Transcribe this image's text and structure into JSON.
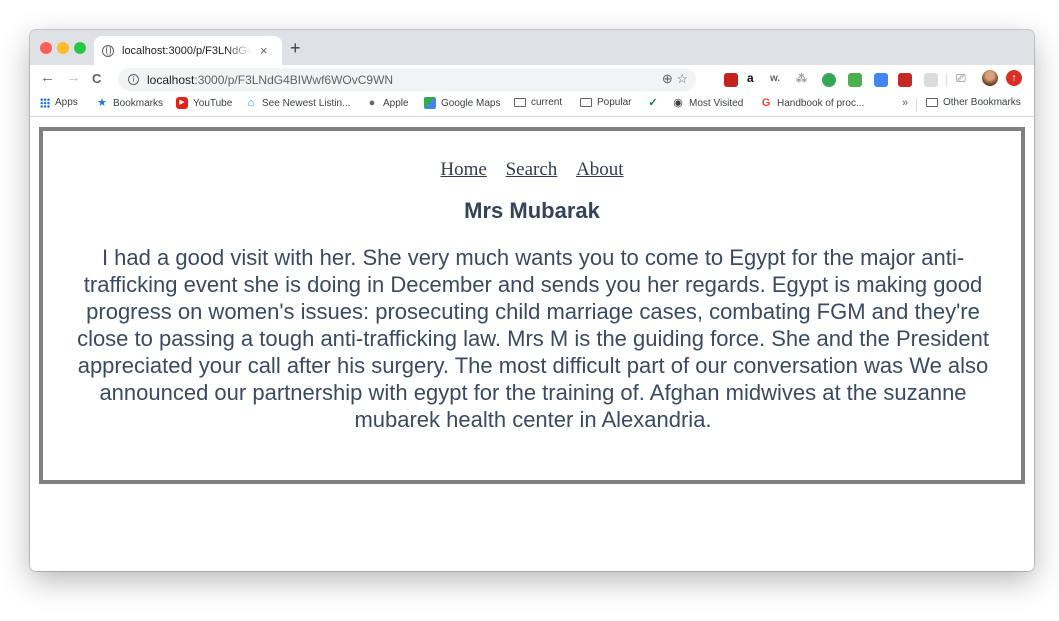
{
  "browser": {
    "tab": {
      "title": "localhost:3000/p/F3LNdG4BIWwf6WOvC9WN",
      "close": "×"
    },
    "new_tab": "+",
    "nav": {
      "back": "←",
      "forward": "→",
      "reload": "C"
    },
    "address": {
      "host": "localhost",
      "rest": ":3000/p/F3LNdG4BIWwf6WOvC9WN"
    },
    "omni_icons": "⊕ ☆",
    "bookmarks": [
      {
        "label": "Apps",
        "icon": "apps-grid-icon"
      },
      {
        "label": "Bookmarks",
        "icon": "star-icon"
      },
      {
        "label": "YouTube",
        "icon": "youtube-icon"
      },
      {
        "label": "See Newest Listin...",
        "icon": "home-icon"
      },
      {
        "label": "Apple",
        "icon": "apple-icon"
      },
      {
        "label": "Google Maps",
        "icon": "maps-icon"
      },
      {
        "label": "current",
        "icon": "folder-icon"
      },
      {
        "label": "Popular",
        "icon": "folder-icon"
      },
      {
        "label": "",
        "icon": "checkmark-icon"
      },
      {
        "label": "Most Visited",
        "icon": "globe-icon"
      },
      {
        "label": "Handbook of proc...",
        "icon": "google-icon"
      }
    ],
    "more_bookmarks": "»",
    "other_bookmarks": "Other Bookmarks",
    "colors": {
      "tabstrip": "#dee1e6",
      "omnibox": "#f1f3f4"
    }
  },
  "site": {
    "nav": {
      "home": "Home",
      "search": "Search",
      "about": "About"
    },
    "title": "Mrs Mubarak",
    "body": "I had a good visit with her. She very much wants you to come to Egypt for the major anti-trafficking event she is doing in December and sends you her regards. Egypt is making good progress on women's issues: prosecuting child marriage cases, combating FGM and they're close to passing a tough anti-trafficking law. Mrs M is the guiding force. She and the President appreciated your call after his surgery. The most difficult part of our conversation was We also announced our partnership with egypt for the training of. Afghan midwives at the suzanne mubarek health center in Alexandria.",
    "colors": {
      "border": "#808080",
      "text": "#3a4a62"
    }
  }
}
